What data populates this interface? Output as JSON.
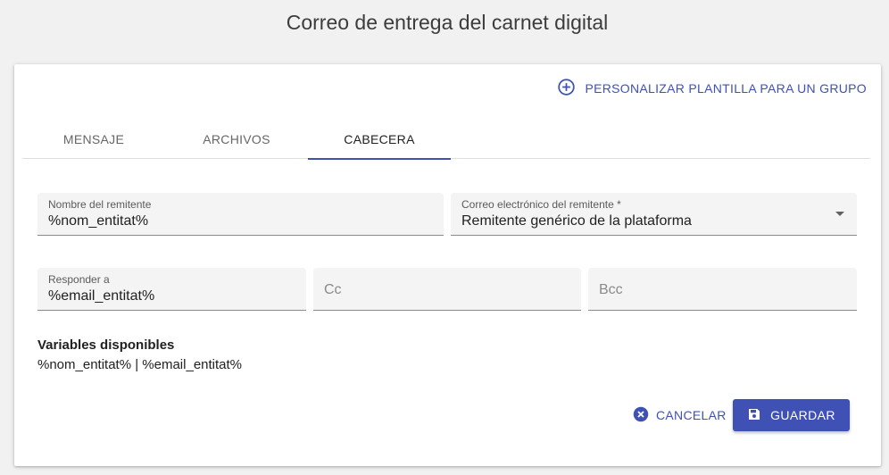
{
  "page": {
    "title": "Correo de entrega del carnet digital"
  },
  "header": {
    "customize_label": "PERSONALIZAR PLANTILLA PARA UN GRUPO",
    "customize_icon": "add-circle-outline-icon"
  },
  "tabs": [
    {
      "label": "MENSAJE",
      "active": false
    },
    {
      "label": "ARCHIVOS",
      "active": false
    },
    {
      "label": "CABECERA",
      "active": true
    }
  ],
  "form": {
    "sender_name": {
      "label": "Nombre del remitente",
      "value": "%nom_entitat%"
    },
    "sender_email": {
      "label": "Correo electrónico del remitente *",
      "value": "Remitente genérico de la plataforma"
    },
    "reply_to": {
      "label": "Responder a",
      "value": "%email_entitat%"
    },
    "cc": {
      "placeholder": "Cc"
    },
    "bcc": {
      "placeholder": "Bcc"
    }
  },
  "variables": {
    "title": "Variables disponibles",
    "list": "%nom_entitat% | %email_entitat%"
  },
  "actions": {
    "cancel_label": "CANCELAR",
    "cancel_icon": "cancel-circle-icon",
    "save_label": "GUARDAR",
    "save_icon": "save-floppy-icon"
  },
  "colors": {
    "accent": "#3f51b5",
    "background": "#f1f1f1",
    "field_bg": "#f4f4f4"
  }
}
